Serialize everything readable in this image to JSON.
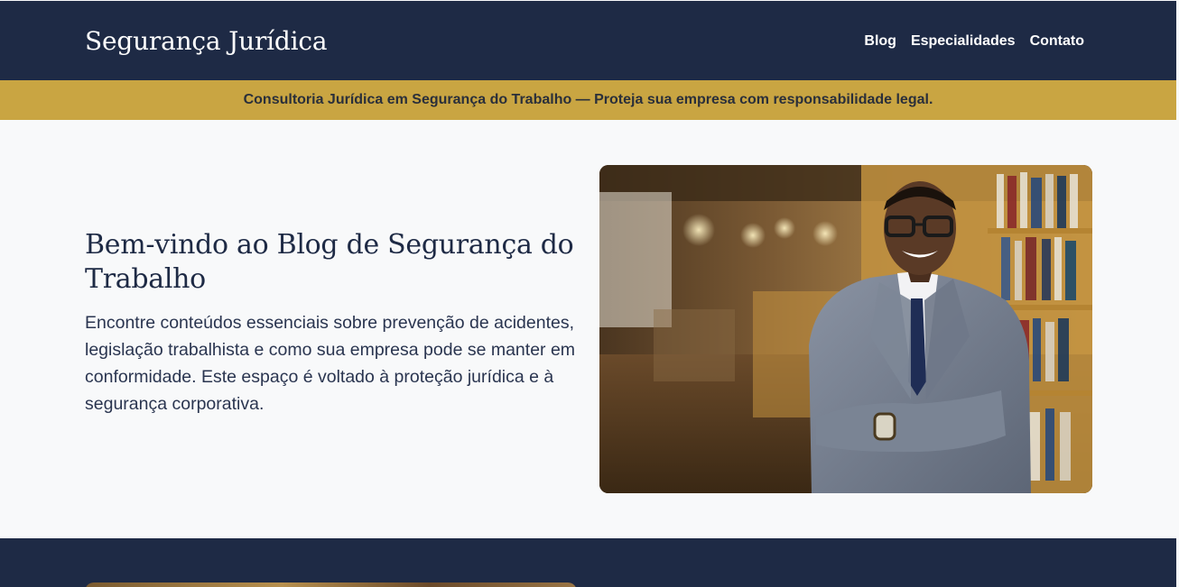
{
  "header": {
    "brand": "Segurança Jurídica",
    "nav": [
      {
        "label": "Blog"
      },
      {
        "label": "Especialidades"
      },
      {
        "label": "Contato"
      }
    ]
  },
  "banner": {
    "text": "Consultoria Jurídica em Segurança do Trabalho — Proteja sua empresa com responsabilidade legal."
  },
  "hero": {
    "title": "Bem-vindo ao Blog de Segurança do Trabalho",
    "description": "Encontre conteúdos essenciais sobre prevenção de acidentes, legislação trabalhista e como sua empresa pode se manter em conformidade. Este espaço é voltado à proteção jurídica e à segurança corporativa.",
    "image_subject": "smiling man in grey suit with arms crossed in a library"
  },
  "colors": {
    "navy": "#1e2a45",
    "gold": "#c9a542",
    "background": "#f8f9fa"
  }
}
